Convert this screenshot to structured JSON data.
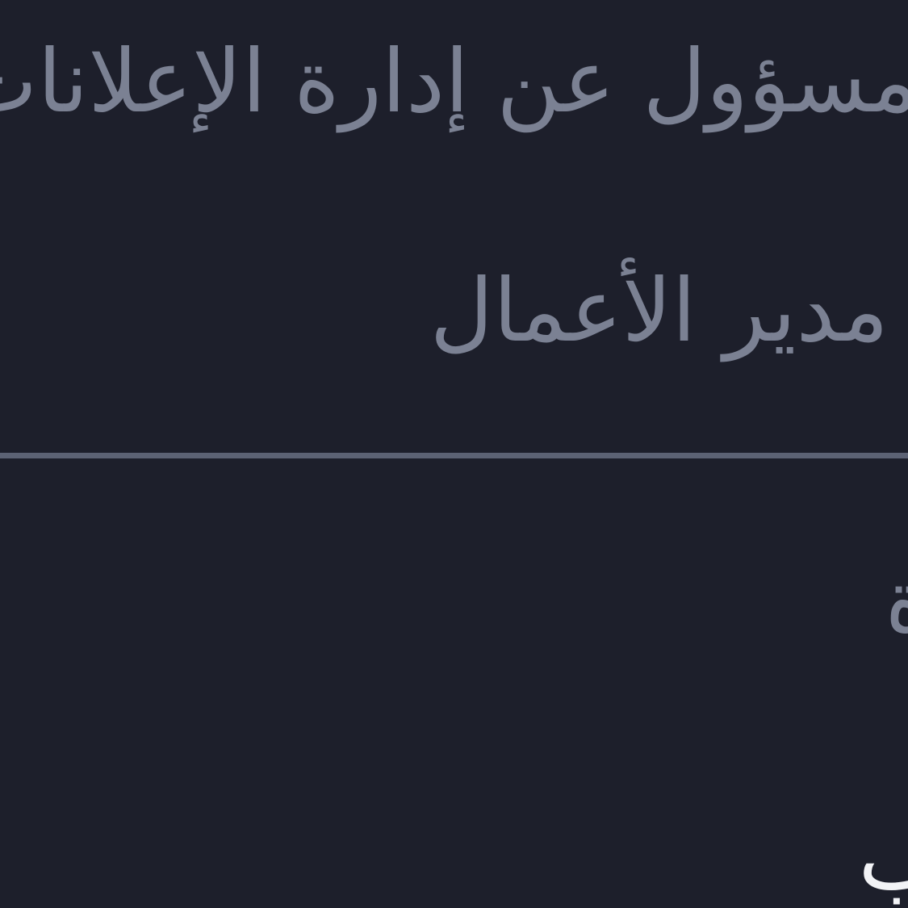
{
  "lines": {
    "line1": "مسؤول عن إدارة الإعلانات",
    "line2": "مدير الأعمال",
    "line3": "ة",
    "line4": "ب"
  },
  "colors": {
    "background": "#1d1f2b",
    "muted_text": "#7b8193",
    "bright_text": "#f2f3f6",
    "divider": "#5c6274"
  }
}
